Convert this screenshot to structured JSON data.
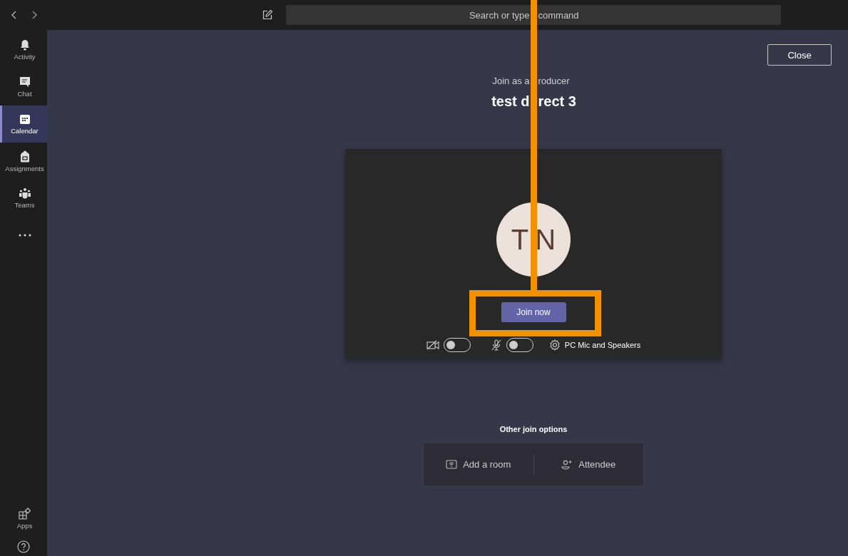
{
  "search": {
    "placeholder": [
      "Search or type",
      "command"
    ]
  },
  "sidebar": {
    "items": [
      {
        "label": "Activity",
        "kind": "bell",
        "selected": false
      },
      {
        "label": "Chat",
        "kind": "chat",
        "selected": false
      },
      {
        "label": "Calendar",
        "kind": "calendar",
        "selected": true
      },
      {
        "label": "Assignments",
        "kind": "backpack",
        "selected": false
      },
      {
        "label": "Teams",
        "kind": "teams",
        "selected": false
      },
      {
        "kind": "more",
        "selected": false
      }
    ],
    "bottom": [
      {
        "label": "Apps",
        "kind": "apps"
      },
      {
        "kind": "help"
      }
    ]
  },
  "close_button": "Close",
  "join_as": [
    "Join as a",
    "roducer"
  ],
  "meeting_title": [
    "test d",
    "rect 3"
  ],
  "preview": {
    "avatar": "TN",
    "join_button": "Join now",
    "camera": {
      "on": false
    },
    "mic": {
      "on": false
    },
    "device": "PC Mic and Speakers"
  },
  "other_options": {
    "title": "Other join options",
    "options": [
      {
        "label": "Add a room",
        "kind": "room"
      },
      {
        "label": "Attendee",
        "kind": "attendee"
      }
    ]
  }
}
